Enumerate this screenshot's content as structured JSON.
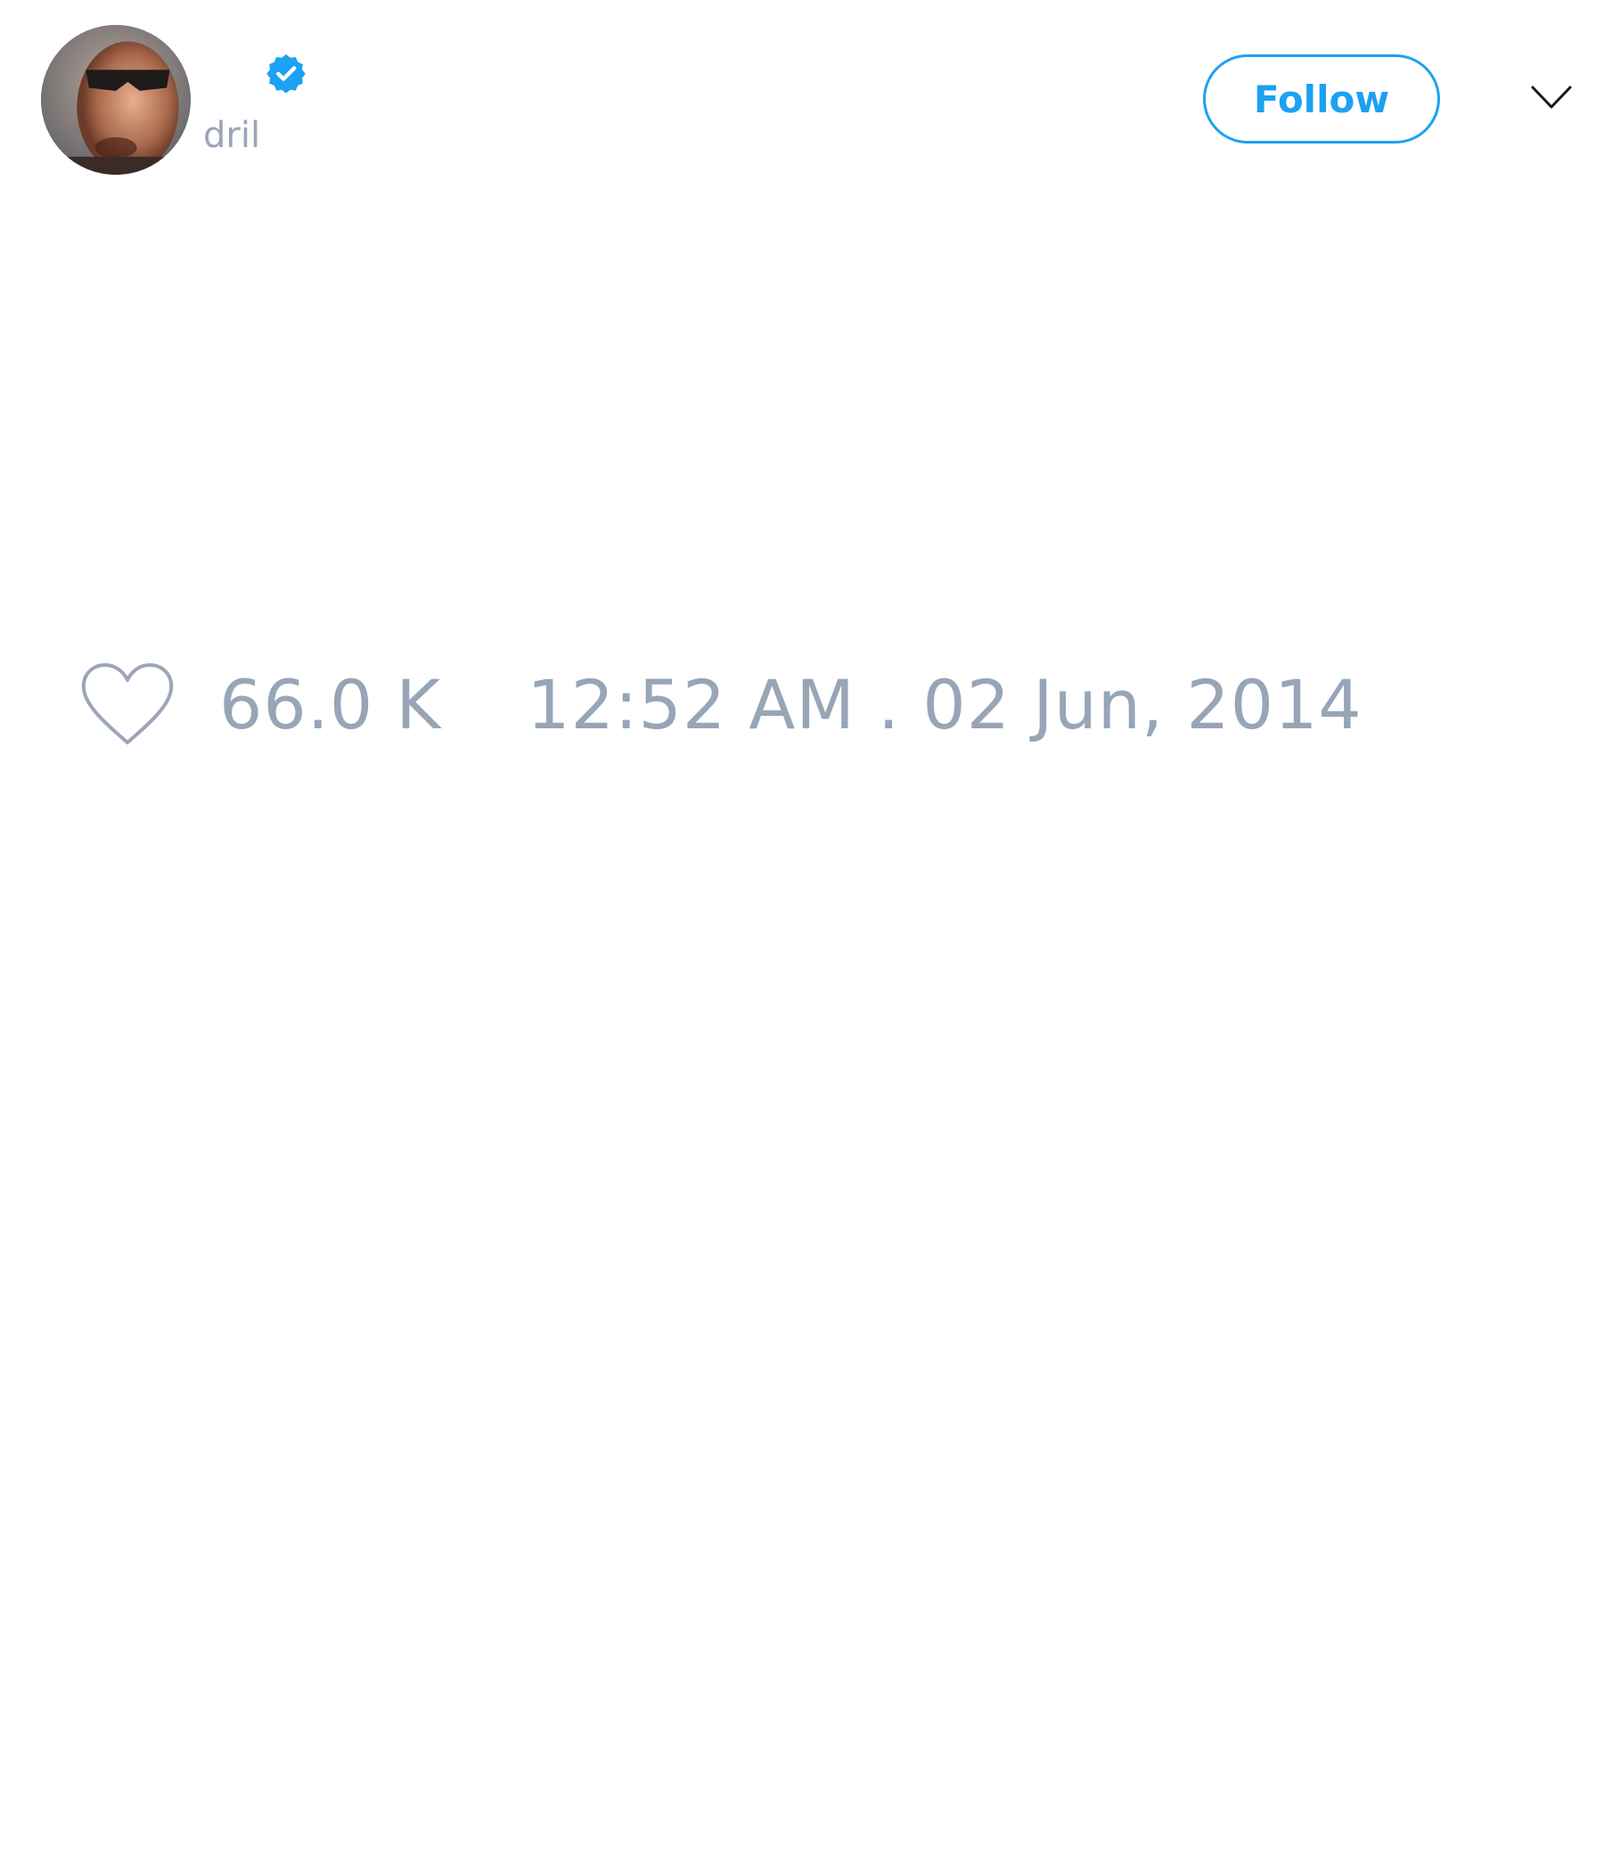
{
  "user": {
    "handle": "dril",
    "avatar_icon": "avatar-photo",
    "verified_icon": "verified-badge-icon",
    "verified_color": "#1da1f2"
  },
  "header": {
    "follow_label": "Follow",
    "menu_icon": "chevron-down-icon"
  },
  "tweet": {
    "like_icon": "heart-icon",
    "like_count": "66.0 K",
    "timestamp": "12:52 AM . 02 Jun, 2014"
  },
  "colors": {
    "accent": "#1da1f2",
    "muted_text": "#97a5b7"
  }
}
